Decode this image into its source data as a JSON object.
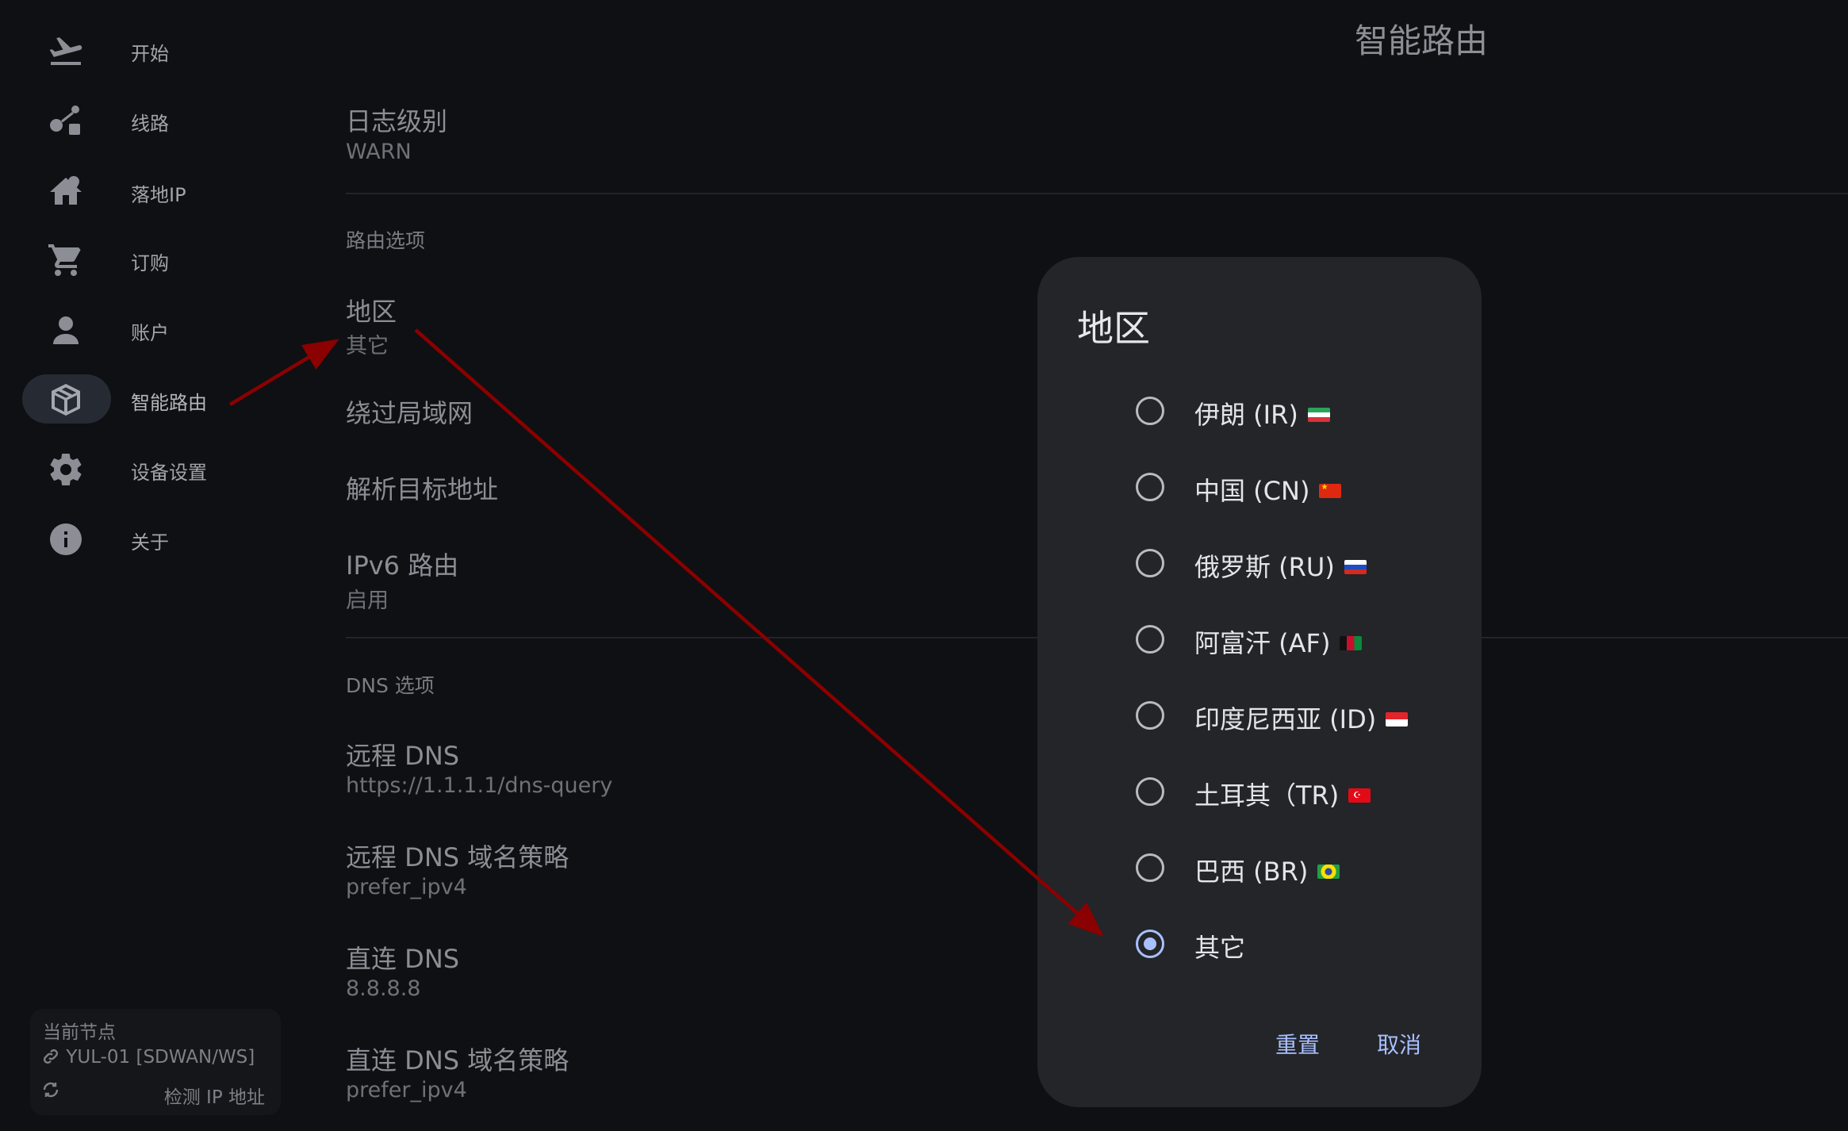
{
  "sidebar": {
    "items": [
      {
        "label": "开始",
        "icon": "airplane-takeoff-icon",
        "active": false
      },
      {
        "label": "线路",
        "icon": "route-icon",
        "active": false
      },
      {
        "label": "落地IP",
        "icon": "home-location-icon",
        "active": false
      },
      {
        "label": "订购",
        "icon": "cart-icon",
        "active": false
      },
      {
        "label": "账户",
        "icon": "account-icon",
        "active": false
      },
      {
        "label": "智能路由",
        "icon": "package-icon",
        "active": true
      },
      {
        "label": "设备设置",
        "icon": "gear-icon",
        "active": false
      },
      {
        "label": "关于",
        "icon": "info-icon",
        "active": false
      }
    ],
    "current_node": {
      "title": "当前节点",
      "name": "YUL-01 [SDWAN/WS]",
      "check_ip": "检测 IP 地址",
      "link_icon": "link-icon",
      "refresh_icon": "refresh-icon"
    }
  },
  "main": {
    "page_title": "智能路由",
    "log_level": {
      "title": "日志级别",
      "value": "WARN"
    },
    "route_section": "路由选项",
    "region": {
      "title": "地区",
      "value": "其它"
    },
    "bypass_lan": "绕过局域网",
    "resolve_target": "解析目标地址",
    "ipv6_route": {
      "title": "IPv6 路由",
      "value": "启用"
    },
    "dns_section": "DNS 选项",
    "remote_dns": {
      "title": "远程 DNS",
      "value": "https://1.1.1.1/dns-query"
    },
    "remote_dns_strategy": {
      "title": "远程 DNS 域名策略",
      "value": "prefer_ipv4"
    },
    "direct_dns": {
      "title": "直连 DNS",
      "value": "8.8.8.8"
    },
    "direct_dns_strategy": {
      "title": "直连 DNS 域名策略",
      "value": "prefer_ipv4"
    }
  },
  "dialog": {
    "title": "地区",
    "options": [
      {
        "label": "伊朗 (IR)",
        "flag": "iran-flag",
        "selected": false
      },
      {
        "label": "中国 (CN)",
        "flag": "china-flag",
        "selected": false
      },
      {
        "label": "俄罗斯 (RU)",
        "flag": "russia-flag",
        "selected": false
      },
      {
        "label": "阿富汗 (AF)",
        "flag": "afghanistan-flag",
        "selected": false
      },
      {
        "label": "印度尼西亚 (ID)",
        "flag": "indonesia-flag",
        "selected": false
      },
      {
        "label": "土耳其（TR)",
        "flag": "turkey-flag",
        "selected": false
      },
      {
        "label": "巴西 (BR)",
        "flag": "brazil-flag",
        "selected": false
      },
      {
        "label": "其它",
        "flag": "",
        "selected": true
      }
    ],
    "reset_label": "重置",
    "cancel_label": "取消"
  },
  "colors": {
    "background": "#0f1013",
    "dialog": "#232529",
    "accent": "#a9c0ff",
    "annotation_arrow": "#8b0000"
  }
}
